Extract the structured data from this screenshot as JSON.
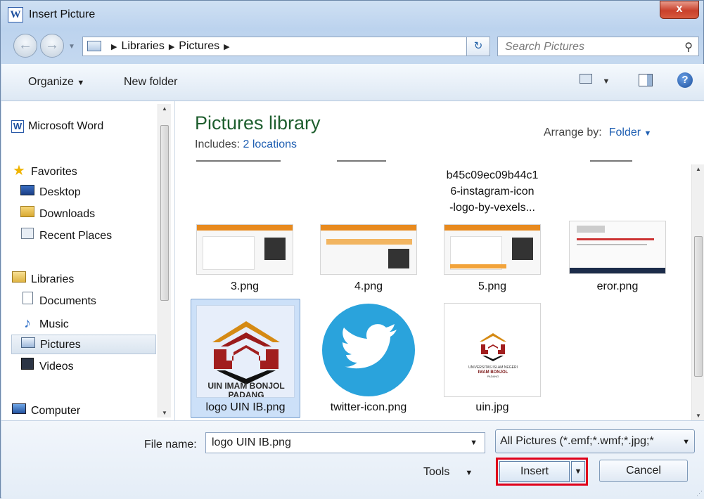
{
  "window": {
    "title": "Insert Picture",
    "app_icon": "W",
    "close_label": "x",
    "icon_names": [
      "word-app-icon",
      "close-icon"
    ]
  },
  "nav": {
    "breadcrumbs": [
      "Libraries",
      "Pictures"
    ],
    "search_placeholder": "Search Pictures"
  },
  "toolbar": {
    "organize_label": "Organize",
    "new_folder_label": "New folder"
  },
  "sidebar": {
    "items": [
      {
        "label": "Microsoft Word",
        "icon": "word-icon"
      },
      {
        "label": "Favorites",
        "icon": "star-icon"
      },
      {
        "label": "Desktop",
        "icon": "desktop-icon"
      },
      {
        "label": "Downloads",
        "icon": "downloads-folder-icon"
      },
      {
        "label": "Recent Places",
        "icon": "recent-places-icon"
      },
      {
        "label": "Libraries",
        "icon": "libraries-icon"
      },
      {
        "label": "Documents",
        "icon": "documents-icon"
      },
      {
        "label": "Music",
        "icon": "music-icon"
      },
      {
        "label": "Pictures",
        "icon": "pictures-icon"
      },
      {
        "label": "Videos",
        "icon": "videos-icon"
      },
      {
        "label": "Computer",
        "icon": "computer-icon"
      }
    ],
    "selected": "Pictures"
  },
  "library": {
    "title": "Pictures library",
    "includes_label": "Includes:",
    "includes_link": "2 locations",
    "arrange_label": "Arrange by:",
    "arrange_value": "Folder"
  },
  "files": {
    "partial_name_lines": [
      "b45c09ec09b44c1",
      "6-instagram-icon",
      "-logo-by-vexels..."
    ],
    "row1": [
      "3.png",
      "4.png",
      "5.png",
      "eror.png"
    ],
    "row2": [
      "logo UIN IB.png",
      "twitter-icon.png",
      "uin.jpg"
    ],
    "logo_caption_lines": [
      "UIN IMAM BONJOL",
      "PADANG"
    ],
    "uin_small_caption": [
      "UNIVERSITAS ISLAM NEGERI",
      "IMAM BONJOL",
      "PADANG"
    ]
  },
  "bottom": {
    "file_name_label": "File name:",
    "file_name_value": "logo UIN IB.png",
    "filter_value": "All Pictures (*.emf;*.wmf;*.jpg;*",
    "tools_label": "Tools",
    "insert_label": "Insert",
    "cancel_label": "Cancel"
  },
  "colors": {
    "accent_link": "#1f5fb2",
    "library_title": "#1e5e2e",
    "highlight_border": "#e0001b",
    "selection_bg": "#cce0f8"
  }
}
